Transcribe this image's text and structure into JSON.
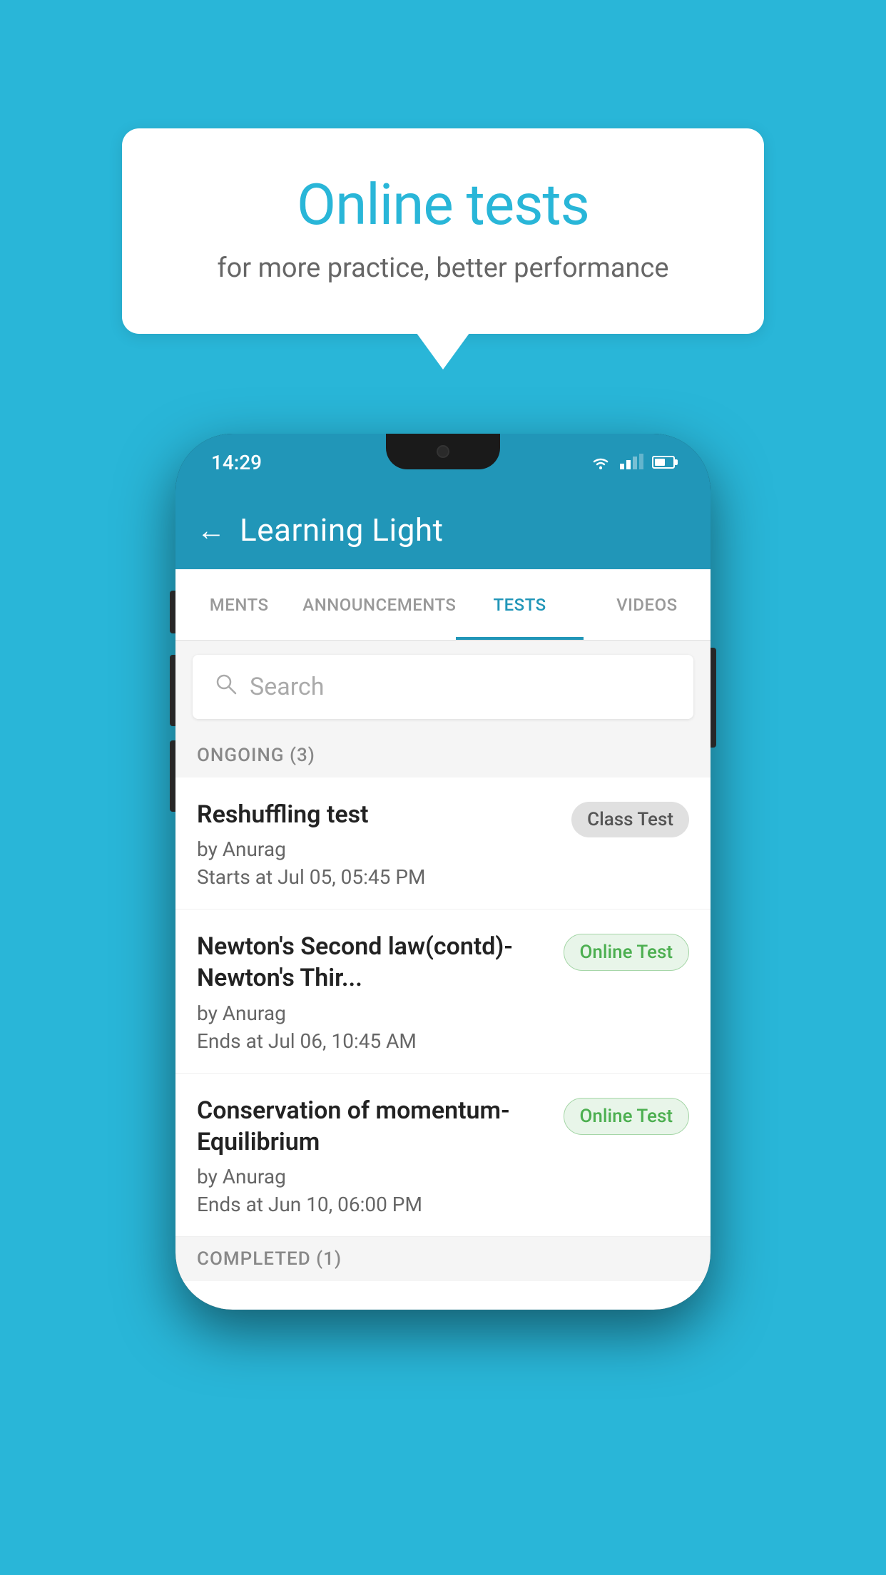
{
  "background_color": "#29B6D8",
  "bubble": {
    "title": "Online tests",
    "subtitle": "for more practice, better performance"
  },
  "phone": {
    "status_bar": {
      "time": "14:29"
    },
    "header": {
      "title": "Learning Light",
      "back_label": "←"
    },
    "tabs": [
      {
        "label": "MENTS",
        "active": false
      },
      {
        "label": "ANNOUNCEMENTS",
        "active": false
      },
      {
        "label": "TESTS",
        "active": true
      },
      {
        "label": "VIDEOS",
        "active": false
      }
    ],
    "search": {
      "placeholder": "Search"
    },
    "sections": [
      {
        "label": "ONGOING (3)",
        "tests": [
          {
            "name": "Reshuffling test",
            "author": "by Anurag",
            "time": "Starts at  Jul 05, 05:45 PM",
            "badge": "Class Test",
            "badge_type": "class"
          },
          {
            "name": "Newton's Second law(contd)-Newton's Thir...",
            "author": "by Anurag",
            "time": "Ends at  Jul 06, 10:45 AM",
            "badge": "Online Test",
            "badge_type": "online"
          },
          {
            "name": "Conservation of momentum-Equilibrium",
            "author": "by Anurag",
            "time": "Ends at  Jun 10, 06:00 PM",
            "badge": "Online Test",
            "badge_type": "online"
          }
        ]
      }
    ],
    "completed_section_label": "COMPLETED (1)"
  }
}
